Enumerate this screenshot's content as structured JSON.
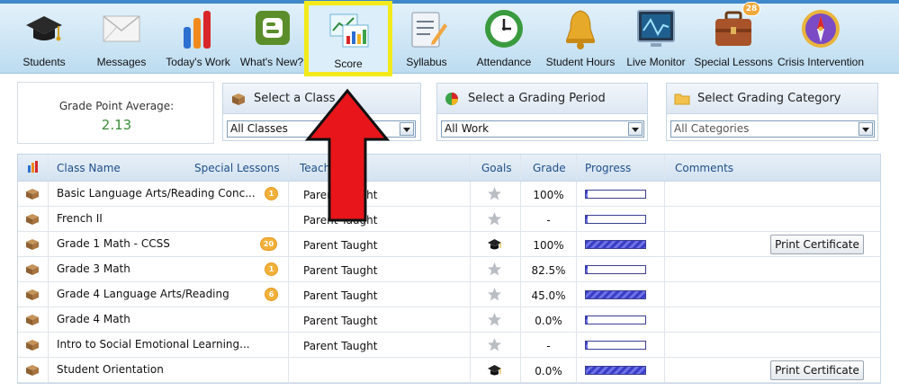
{
  "toolbar": {
    "items": [
      {
        "label": "Students",
        "icon": "graduation-cap-icon"
      },
      {
        "label": "Messages",
        "icon": "envelope-icon"
      },
      {
        "label": "Today's Work",
        "icon": "bar-chart-icon"
      },
      {
        "label": "What's New?",
        "icon": "blogger-icon"
      },
      {
        "label": "Score",
        "icon": "score-chart-icon"
      },
      {
        "label": "Syllabus",
        "icon": "notepad-pencil-icon"
      },
      {
        "label": "Attendance",
        "icon": "clock-icon"
      },
      {
        "label": "Student Hours",
        "icon": "bell-icon"
      },
      {
        "label": "Live Monitor",
        "icon": "monitor-icon"
      },
      {
        "label": "Special Lessons",
        "icon": "briefcase-icon",
        "badge": "28"
      },
      {
        "label": "Crisis Intervention",
        "icon": "compass-icon"
      }
    ],
    "active": "Score",
    "highlight_color": "#f2ea1c"
  },
  "gpa": {
    "label": "Grade Point Average:",
    "value": "2.13"
  },
  "filters": {
    "class": {
      "header": "Select a Class",
      "selected": "All Classes",
      "icon": "box-icon"
    },
    "period": {
      "header": "Select a Grading Period",
      "selected": "All Work",
      "icon": "pie-chart-icon"
    },
    "category": {
      "header": "Select Grading Category",
      "selected": "All Categories",
      "icon": "folder-icon"
    }
  },
  "table": {
    "headers": {
      "class_name": "Class Name",
      "special_lessons": "Special Lessons",
      "teacher": "Teacher",
      "goals": "Goals",
      "grade": "Grade",
      "progress": "Progress",
      "comments": "Comments"
    },
    "rows": [
      {
        "name": "Basic Language Arts/Reading Conc...",
        "badge": "1",
        "teacher": "Parent Taught",
        "goal": "star",
        "grade": "100%",
        "progress": 0,
        "certificate": ""
      },
      {
        "name": "French II",
        "badge": "",
        "teacher": "Parent Taught",
        "goal": "star",
        "grade": "-",
        "progress": 0,
        "certificate": ""
      },
      {
        "name": "Grade 1 Math - CCSS",
        "badge": "20",
        "teacher": "Parent Taught",
        "goal": "cap",
        "grade": "100%",
        "progress": 1.0,
        "certificate": "Print Certificate"
      },
      {
        "name": "Grade 3 Math",
        "badge": "1",
        "teacher": "Parent Taught",
        "goal": "star",
        "grade": "82.5%",
        "progress": 0,
        "certificate": ""
      },
      {
        "name": "Grade 4 Language Arts/Reading",
        "badge": "6",
        "teacher": "Parent Taught",
        "goal": "star",
        "grade": "45.0%",
        "progress": 1.0,
        "certificate": ""
      },
      {
        "name": "Grade 4 Math",
        "badge": "",
        "teacher": "Parent Taught",
        "goal": "star",
        "grade": "0.0%",
        "progress": 0,
        "certificate": ""
      },
      {
        "name": "Intro to Social Emotional Learning...",
        "badge": "",
        "teacher": "Parent Taught",
        "goal": "star",
        "grade": "-",
        "progress": 0,
        "certificate": ""
      },
      {
        "name": "Student Orientation",
        "badge": "",
        "teacher": "",
        "goal": "cap",
        "grade": "0.0%",
        "progress": 1.0,
        "certificate": "Print Certificate"
      }
    ]
  },
  "annotation": {
    "arrow_color": "#e8151b"
  }
}
